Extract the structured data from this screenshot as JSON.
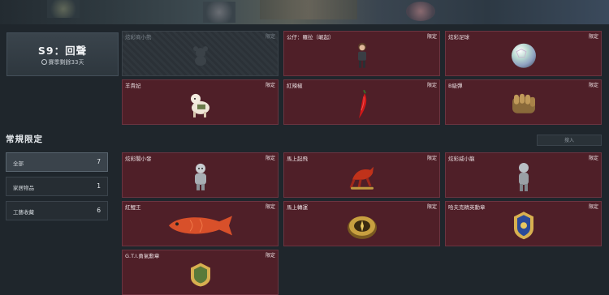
{
  "season": {
    "title": "S9：回聲",
    "remaining": "賽季剩餘33天"
  },
  "season_items": [
    {
      "name": "炫彩商小熊",
      "tag": "限定",
      "icon": "bear-silhouette-icon",
      "locked": true
    },
    {
      "name": "公仔：羅拉（崛起）",
      "tag": "限定",
      "icon": "figure-girl-icon",
      "locked": false
    },
    {
      "name": "炫彩足球",
      "tag": "限定",
      "icon": "iridescent-ball-icon",
      "locked": false
    },
    {
      "name": "羊貴妃",
      "tag": "限定",
      "icon": "alpaca-figure-icon",
      "locked": false
    },
    {
      "name": "紅辣椒",
      "tag": "限定",
      "icon": "red-chili-icon",
      "locked": false
    },
    {
      "name": "B級彈",
      "tag": "限定",
      "icon": "golden-fist-icon",
      "locked": false
    }
  ],
  "section_title": "常規限定",
  "filters": [
    {
      "label": "全部",
      "count": "7",
      "active": true
    },
    {
      "label": "家居物品",
      "count": "1",
      "active": false
    },
    {
      "label": "工藝收藏",
      "count": "6",
      "active": false
    }
  ],
  "search": {
    "placeholder": "搜入"
  },
  "regular_items": [
    {
      "name": "炫彩閣小發",
      "tag": "限定",
      "icon": "silver-figurine-icon"
    },
    {
      "name": "馬上起飛",
      "tag": "限定",
      "icon": "red-horse-icon"
    },
    {
      "name": "炫彩威小龍",
      "tag": "限定",
      "icon": "silver-dragon-icon"
    },
    {
      "name": "紅鯉王",
      "tag": "限定",
      "icon": "red-carp-icon"
    },
    {
      "name": "馬上轉運",
      "tag": "限定",
      "icon": "gold-compass-icon"
    },
    {
      "name": "哈夫克精英勳章",
      "tag": "限定",
      "icon": "blue-gold-medal-icon"
    },
    {
      "name": "G.T.I.勇氣勳章",
      "tag": "限定",
      "icon": "green-gold-medal-icon"
    }
  ]
}
